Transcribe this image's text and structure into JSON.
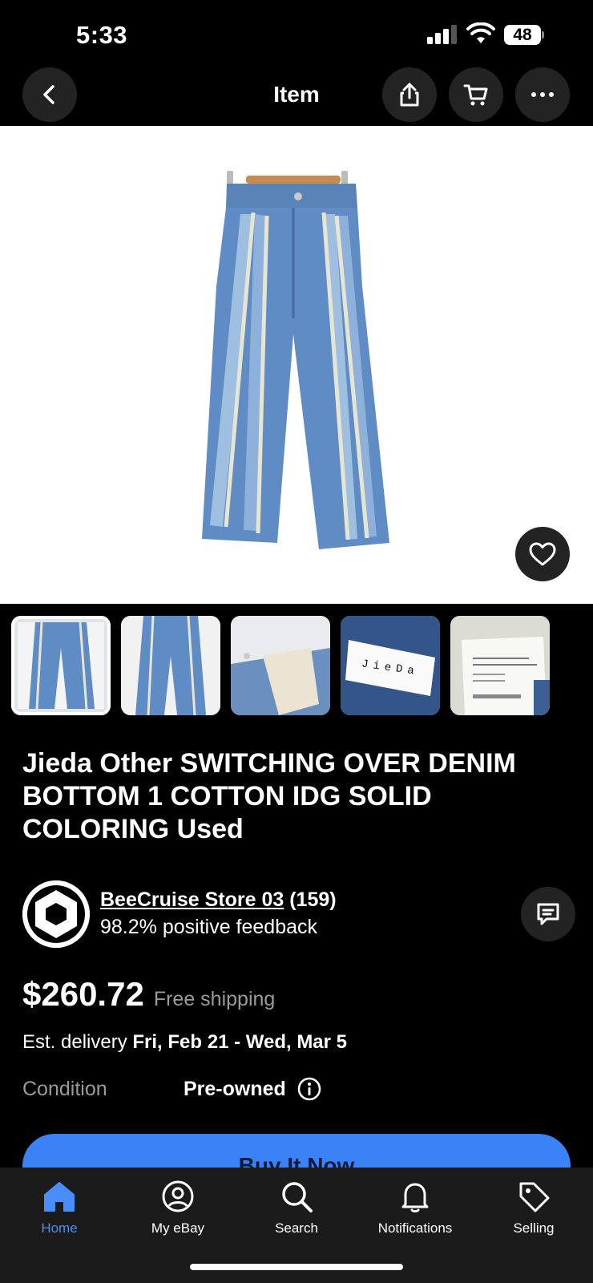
{
  "status_bar": {
    "time": "5:33",
    "battery": "48"
  },
  "nav": {
    "title": "Item"
  },
  "item": {
    "title": "Jieda Other SWITCHING OVER DENIM BOTTOM 1 COTTON IDG SOLID COLORING Used",
    "thumbnail_count": 5,
    "thumbnail_label_text": "JieDa"
  },
  "seller": {
    "name": "BeeCruise Store 03",
    "count": "(159)",
    "feedback": "98.2% positive feedback"
  },
  "price": {
    "amount": "$260.72",
    "shipping": "Free shipping"
  },
  "delivery": {
    "label": "Est. delivery",
    "dates": "Fri, Feb 21 - Wed, Mar 5"
  },
  "condition": {
    "label": "Condition",
    "value": "Pre-owned"
  },
  "buy_button": {
    "label": "Buy It Now"
  },
  "tabs": [
    {
      "label": "Home",
      "icon": "home-icon",
      "active": true
    },
    {
      "label": "My eBay",
      "icon": "user-icon"
    },
    {
      "label": "Search",
      "icon": "search-icon"
    },
    {
      "label": "Notifications",
      "icon": "bell-icon"
    },
    {
      "label": "Selling",
      "icon": "tag-icon"
    }
  ],
  "colors": {
    "accent": "#3b82f6",
    "tab_active": "#4a8dff",
    "background": "#000000"
  }
}
